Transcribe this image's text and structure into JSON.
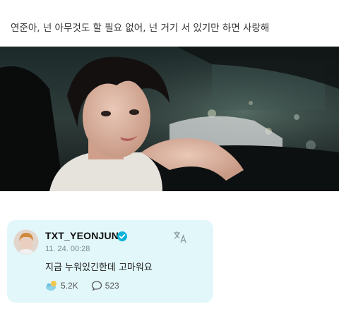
{
  "caption": "연준아, 넌 아무것도 할 필요 없어, 넌 거기 서 있기만 하면 사랑해",
  "post": {
    "username": "TXT_YEONJUN",
    "timestamp": "11. 24. 00:28",
    "text": "지금 누워있긴한데 고마워요",
    "likes": "5.2K",
    "comments": "523",
    "icons": {
      "verified": "verified-badge-icon",
      "translate": "translate-icon",
      "like": "like-reaction-icon",
      "comment": "comment-bubble-icon"
    }
  },
  "colors": {
    "card_background": "#e2f7fa",
    "verified": "#0bb3d9"
  }
}
